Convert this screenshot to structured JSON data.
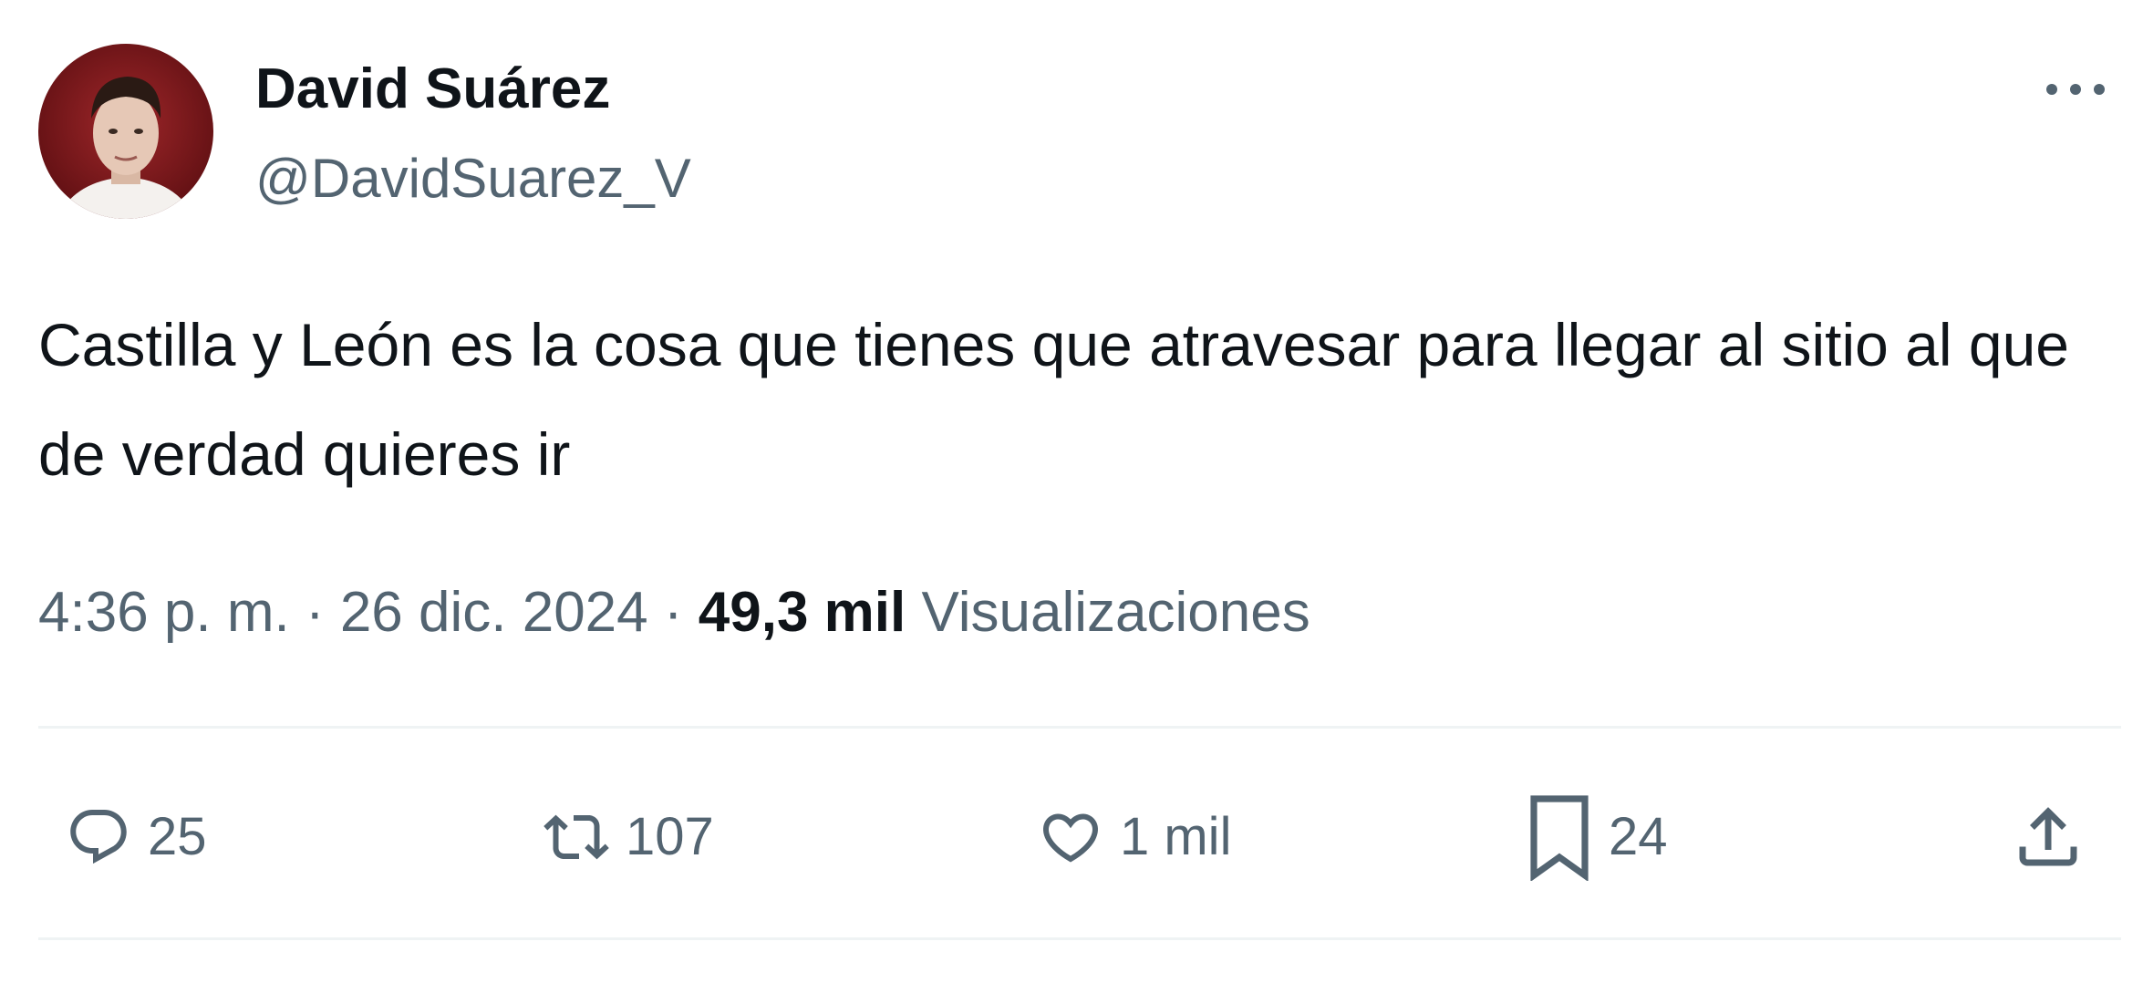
{
  "author": {
    "display_name": "David Suárez",
    "handle": "@DavidSuarez_V",
    "avatar_icon": "profile-photo"
  },
  "tweet": {
    "text": "Castilla y León es la cosa que tienes que atravesar para llegar al sitio al que de verdad quieres ir"
  },
  "meta": {
    "time": "4:36 p. m.",
    "separator": "·",
    "date": "26 dic. 2024",
    "views_count": "49,3 mil",
    "views_label": "Visualizaciones"
  },
  "actions": {
    "reply_count": "25",
    "retweet_count": "107",
    "like_count": "1 mil",
    "bookmark_count": "24"
  },
  "icons": {
    "more": "more-horizontal-icon",
    "reply": "reply-icon",
    "retweet": "retweet-icon",
    "like": "heart-icon",
    "bookmark": "bookmark-icon",
    "share": "share-icon"
  },
  "colors": {
    "text_primary": "#0f1419",
    "text_secondary": "#536471",
    "divider": "#eff3f4"
  }
}
